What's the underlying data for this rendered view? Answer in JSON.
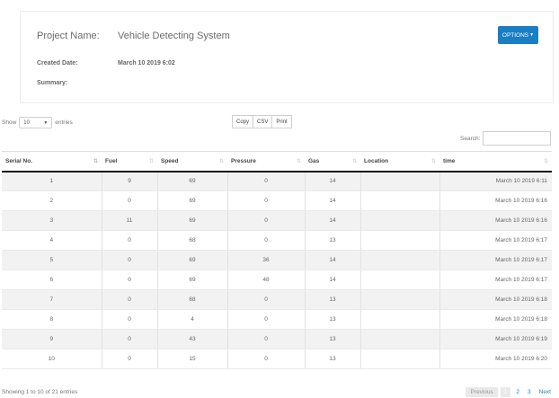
{
  "project": {
    "name_label": "Project Name:",
    "name_value": "Vehicle Detecting System",
    "created_label": "Created Date:",
    "created_value": "March 10 2019 6:02",
    "summary_label": "Summary:",
    "options_label": "OPTIONS"
  },
  "controls": {
    "show_label": "Show",
    "length_value": "10",
    "entries_label": "entries",
    "buttons": [
      "Copy",
      "CSV",
      "Print"
    ],
    "search_label": "Search:",
    "search_value": ""
  },
  "table": {
    "columns": [
      "Serial No.",
      "Fuel",
      "Speed",
      "Pressure",
      "Gas",
      "Location",
      "time"
    ],
    "rows": [
      [
        "1",
        "9",
        "69",
        "0",
        "14",
        "",
        "March 10 2019 6:11"
      ],
      [
        "2",
        "0",
        "69",
        "0",
        "14",
        "",
        "March 10 2019 6:16"
      ],
      [
        "3",
        "11",
        "69",
        "0",
        "14",
        "",
        "March 10 2019 6:16"
      ],
      [
        "4",
        "0",
        "68",
        "0",
        "13",
        "",
        "March 10 2019 6:17"
      ],
      [
        "5",
        "0",
        "69",
        "36",
        "14",
        "",
        "March 10 2019 6:17"
      ],
      [
        "6",
        "0",
        "69",
        "48",
        "14",
        "",
        "March 10 2019 6:17"
      ],
      [
        "7",
        "0",
        "68",
        "0",
        "13",
        "",
        "March 10 2019 6:18"
      ],
      [
        "8",
        "0",
        "4",
        "0",
        "13",
        "",
        "March 10 2019 6:18"
      ],
      [
        "9",
        "0",
        "43",
        "0",
        "13",
        "",
        "March 10 2019 6:19"
      ],
      [
        "10",
        "0",
        "15",
        "0",
        "13",
        "",
        "March 10 2019 6:20"
      ]
    ]
  },
  "footer": {
    "info": "Showing 1 to 10 of 21 entries",
    "previous": "Previous",
    "pages": [
      "1",
      "2",
      "3"
    ],
    "next": "Next"
  },
  "colors": {
    "accent": "#1a7ec4",
    "stripe": "#f2f2f2"
  }
}
